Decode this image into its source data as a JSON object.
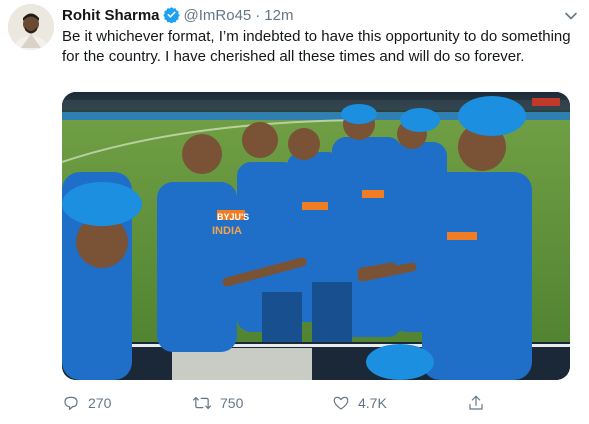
{
  "tweet": {
    "author_name": "Rohit Sharma",
    "handle": "@ImRo45",
    "separator": "·",
    "time": "12m",
    "text": "Be it whichever format, I’m indebted to have this opportunity to do something for the country. I have cherished all these times and will do so forever.",
    "verified": true
  },
  "media": {
    "watermark_text": "BYJU'S",
    "jersey_text": "INDIA"
  },
  "actions": {
    "replies": "270",
    "retweets": "750",
    "likes": "4.7K"
  },
  "colors": {
    "accent": "#1da1f2",
    "muted": "#657786",
    "jersey_blue": "#1f6fc9",
    "pitch_green": "#5a8f3a"
  }
}
